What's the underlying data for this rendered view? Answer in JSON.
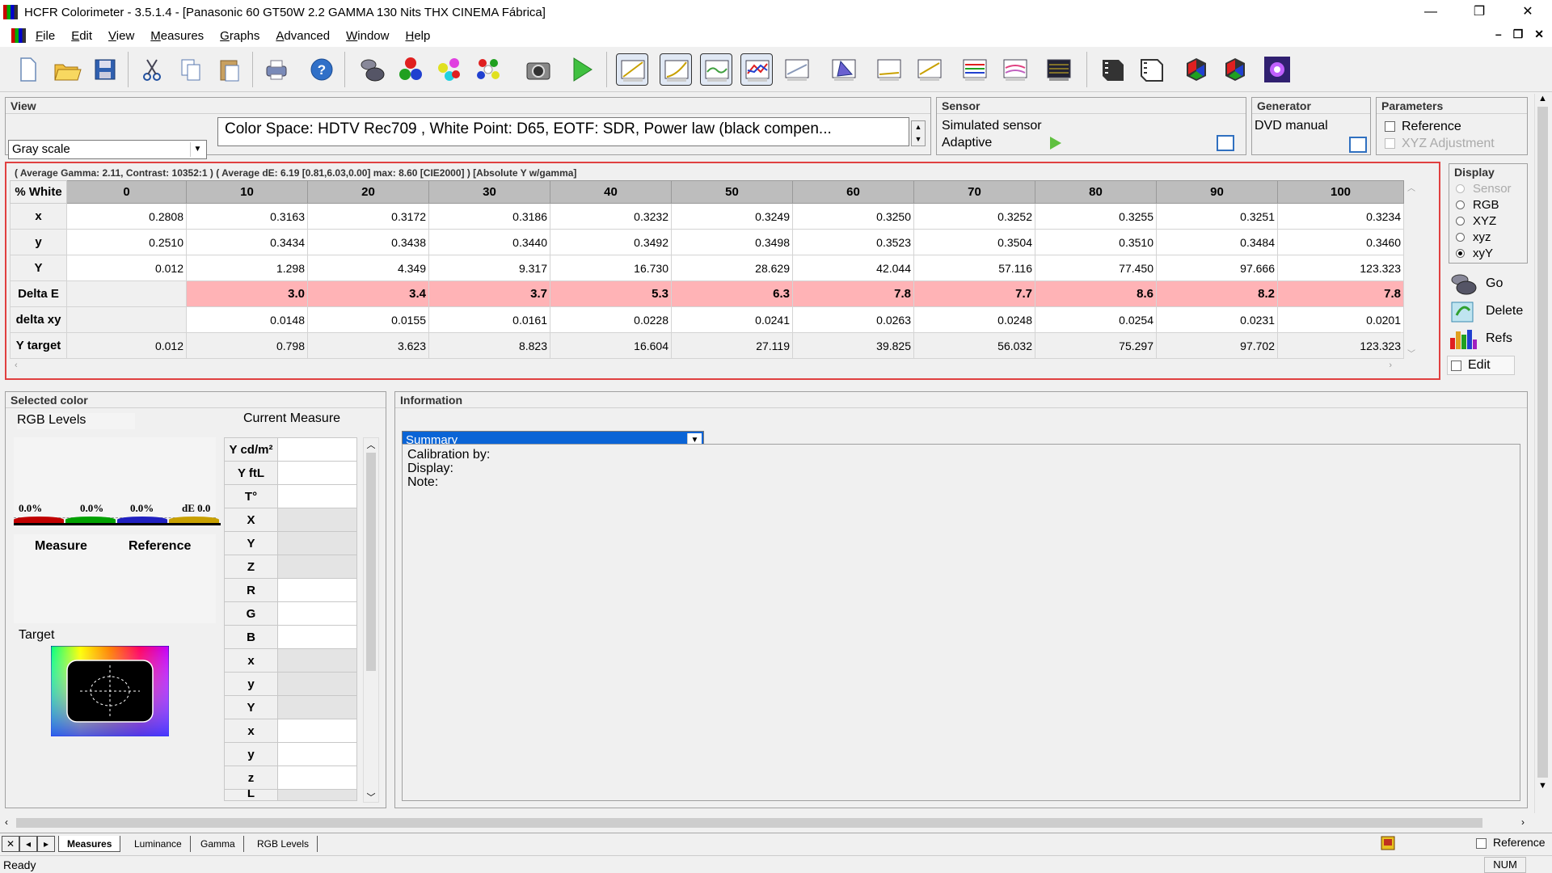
{
  "window": {
    "title": "HCFR Colorimeter - 3.5.1.4 - [Panasonic 60 GT50W 2.2 GAMMA 130 Nits THX CINEMA Fábrica]",
    "minimize": "—",
    "restore": "❐",
    "close": "✕"
  },
  "menu": {
    "items": [
      "File",
      "Edit",
      "View",
      "Measures",
      "Graphs",
      "Advanced",
      "Window",
      "Help"
    ],
    "mdi_min": "–",
    "mdi_restore": "❐",
    "mdi_close": "✕"
  },
  "toolbar": {
    "icons": [
      "new-document-icon",
      "open-folder-icon",
      "save-icon",
      "cut-icon",
      "copy-icon",
      "paste-icon",
      "print-icon",
      "help-icon",
      "sensor-icon",
      "primaries-icon",
      "secondaries-icon",
      "all-colors-icon",
      "camera-icon",
      "play-icon",
      "graph-view-1-icon",
      "graph-view-2-icon",
      "graph-view-3-icon",
      "graph-view-4-icon",
      "graph-view-5-icon",
      "cie-chart-icon",
      "graph-view-7-icon",
      "graph-view-8-icon",
      "rgb-graph-icon",
      "color-temp-graph-icon",
      "measure-screen-icon",
      "film-icon",
      "film-outline-icon",
      "cube-icon",
      "cube-2-icon",
      "starburst-icon"
    ]
  },
  "view_panel": {
    "header": "View",
    "mode": "Gray scale",
    "info": "Color Space: HDTV Rec709 , White Point: D65, EOTF:  SDR, Power law (black compen..."
  },
  "sensor_panel": {
    "header": "Sensor",
    "name": "Simulated sensor",
    "mode": "Adaptive"
  },
  "generator_panel": {
    "header": "Generator",
    "name": "DVD manual"
  },
  "parameters_panel": {
    "header": "Parameters",
    "reference_label": "Reference",
    "xyz_adjust_label": "XYZ Adjustment"
  },
  "grid": {
    "summary": "( Average Gamma: 2.11, Contrast: 10352:1 ) ( Average dE: 6.19 [0.81,6.03,0.00] max: 8.60 [CIE2000] ) [Absolute Y w/gamma]",
    "corner": "% White",
    "columns": [
      "0",
      "10",
      "20",
      "30",
      "40",
      "50",
      "60",
      "70",
      "80",
      "90",
      "100"
    ],
    "rows": [
      {
        "label": "x",
        "values": [
          "0.2808",
          "0.3163",
          "0.3172",
          "0.3186",
          "0.3232",
          "0.3249",
          "0.3250",
          "0.3252",
          "0.3255",
          "0.3251",
          "0.3234"
        ]
      },
      {
        "label": "y",
        "values": [
          "0.2510",
          "0.3434",
          "0.3438",
          "0.3440",
          "0.3492",
          "0.3498",
          "0.3523",
          "0.3504",
          "0.3510",
          "0.3484",
          "0.3460"
        ]
      },
      {
        "label": "Y",
        "values": [
          "0.012",
          "1.298",
          "4.349",
          "9.317",
          "16.730",
          "28.629",
          "42.044",
          "57.116",
          "77.450",
          "97.666",
          "123.323"
        ]
      },
      {
        "label": "Delta E",
        "values": [
          "",
          "3.0",
          "3.4",
          "3.7",
          "5.3",
          "6.3",
          "7.8",
          "7.7",
          "8.6",
          "8.2",
          "7.8"
        ]
      },
      {
        "label": "delta xy",
        "values": [
          "",
          "0.0148",
          "0.0155",
          "0.0161",
          "0.0228",
          "0.0241",
          "0.0263",
          "0.0248",
          "0.0254",
          "0.0231",
          "0.0201"
        ]
      },
      {
        "label": "Y target",
        "values": [
          "0.012",
          "0.798",
          "3.623",
          "8.823",
          "16.604",
          "27.119",
          "39.825",
          "56.032",
          "75.297",
          "97.702",
          "123.323"
        ]
      }
    ]
  },
  "display_panel": {
    "header": "Display",
    "options": [
      "Sensor",
      "RGB",
      "XYZ",
      "xyz",
      "xyY"
    ],
    "selected": "xyY",
    "go_label": "Go",
    "delete_label": "Delete",
    "refs_label": "Refs",
    "edit_label": "Edit"
  },
  "selected_color": {
    "header": "Selected color",
    "rgb_levels_label": "RGB Levels",
    "current_measure_label": "Current Measure",
    "bars": [
      "0.0%",
      "0.0%",
      "0.0%",
      "dE 0.0"
    ],
    "bar_colors": [
      "#c00000",
      "#00a000",
      "#2020c0",
      "#c8a000"
    ],
    "measure_label": "Measure",
    "reference_label": "Reference",
    "target_label": "Target",
    "measure_rows": [
      "Y cd/m²",
      "Y ftL",
      "T°",
      "X",
      "Y",
      "Z",
      "R",
      "G",
      "B",
      "x",
      "y",
      "Y",
      "x",
      "y",
      "z",
      "L"
    ]
  },
  "info_panel": {
    "header": "Information",
    "selection": "Summary",
    "lines": [
      "Calibration by:",
      "Display:",
      "Note:"
    ]
  },
  "tabs": {
    "items": [
      "Measures",
      "Luminance",
      "Gamma",
      "RGB Levels"
    ],
    "active": "Measures",
    "reference_label": "Reference"
  },
  "status": {
    "text": "Ready",
    "num": "NUM"
  }
}
